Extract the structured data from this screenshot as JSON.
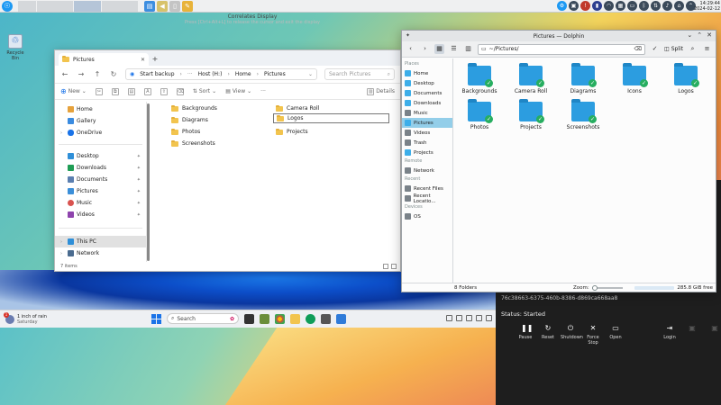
{
  "kde_panel": {
    "clock_time": "14:29:44",
    "clock_date": "2024-02-12"
  },
  "connection": {
    "title": "Correlates Display",
    "subtitle": "Press [Ctrl+Alt+L] to release the cursor and exit the display"
  },
  "desktop": {
    "recycle_bin_label": "Recycle Bin"
  },
  "explorer": {
    "tab_title": "Pictures",
    "tab_close": "✕",
    "new_tab": "+",
    "address_start": "Start backup",
    "breadcrumb": [
      "Host (H:)",
      "Home",
      "Pictures"
    ],
    "search_placeholder": "Search Pictures",
    "toolbar": {
      "new_label": "New",
      "sort_label": "Sort",
      "view_label": "View",
      "more_label": "···",
      "details_label": "Details"
    },
    "nav": {
      "home": "Home",
      "gallery": "Gallery",
      "onedrive": "OneDrive",
      "desktop": "Desktop",
      "downloads": "Downloads",
      "documents": "Documents",
      "pictures": "Pictures",
      "music": "Music",
      "videos": "Videos",
      "this_pc": "This PC",
      "network": "Network"
    },
    "files": {
      "backgrounds": "Backgrounds",
      "diagrams": "Diagrams",
      "photos": "Photos",
      "screenshots": "Screenshots",
      "camera_roll": "Camera Roll",
      "logos": "Logos",
      "projects": "Projects"
    },
    "status": "7 items"
  },
  "taskbar": {
    "weather_text": "1 inch of rain",
    "weather_sub": "Saturday",
    "search_label": "Search"
  },
  "remote": {
    "uuid": "76c38663-6375-460b-8386-d869ca668aa8",
    "status": "Status: Started",
    "buttons": {
      "pause": "Pause",
      "reset": "Reset",
      "shutdown": "Shutdown",
      "force_stop": "Force Stop",
      "open": "Open",
      "login": "Login"
    }
  },
  "dolphin": {
    "title": "Pictures — Dolphin",
    "path": "~/Pictures/",
    "split_label": "Split",
    "places": {
      "places_head": "Places",
      "home": "Home",
      "desktop": "Desktop",
      "documents": "Documents",
      "downloads": "Downloads",
      "music": "Music",
      "pictures": "Pictures",
      "videos": "Videos",
      "trash": "Trash",
      "projects": "Projects",
      "remote_head": "Remote",
      "network": "Network",
      "recent_head": "Recent",
      "recent_files": "Recent Files",
      "recent_locations": "Recent Locatio...",
      "devices_head": "Devices",
      "os": "OS"
    },
    "folders": {
      "backgrounds": "Backgrounds",
      "camera_roll": "Camera Roll",
      "diagrams": "Diagrams",
      "icons": "Icons",
      "logos": "Logos",
      "photos": "Photos",
      "projects": "Projects",
      "screenshots": "Screenshots"
    },
    "status_count": "8 Folders",
    "zoom_label": "Zoom:",
    "free_space": "285.8 GiB free"
  },
  "colors": {
    "kde_accent": "#3daee9",
    "win_folder": "#f2c44e",
    "dolphin_folder": "#2c9de0",
    "sync_check": "#27ae60"
  }
}
